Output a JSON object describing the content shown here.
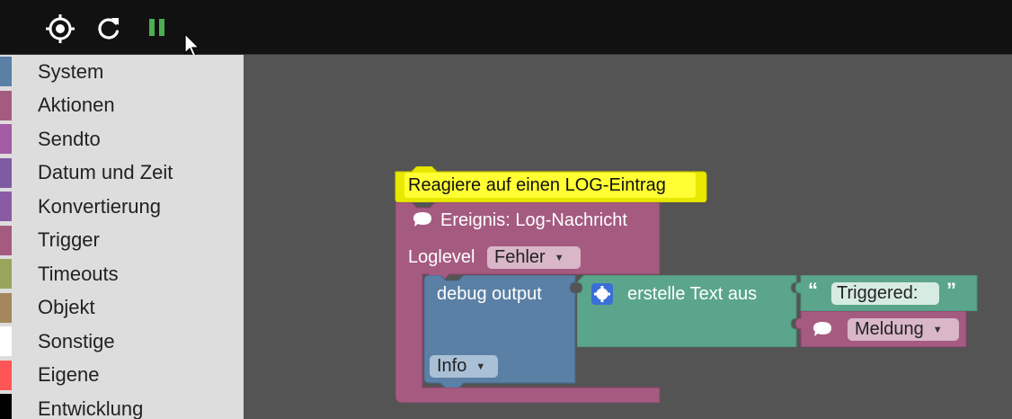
{
  "toolbar": {
    "buttons": [
      {
        "icon": "crosshair-icon"
      },
      {
        "icon": "refresh-icon"
      },
      {
        "icon": "pause-icon",
        "color": "#4caf50"
      }
    ]
  },
  "sidebar": {
    "categories": [
      {
        "label": "System",
        "color": "#5b80a5"
      },
      {
        "label": "Aktionen",
        "color": "#a55b80"
      },
      {
        "label": "Sendto",
        "color": "#a55ba5"
      },
      {
        "label": "Datum und Zeit",
        "color": "#805ba5"
      },
      {
        "label": "Konvertierung",
        "color": "#8a5ba5"
      },
      {
        "label": "Trigger",
        "color": "#a55b80"
      },
      {
        "label": "Timeouts",
        "color": "#99a55b"
      },
      {
        "label": "Objekt",
        "color": "#a5875b"
      },
      {
        "label": "Sonstige",
        "color": "#ffffff"
      },
      {
        "label": "Eigene",
        "color": "#ff5555"
      },
      {
        "label": "Entwicklung",
        "color": "#000000"
      }
    ]
  },
  "blocks": {
    "comment": "Reagiere auf einen LOG-Eintrag",
    "event": {
      "title": "Ereignis: Log-Nachricht",
      "loglevel_label": "Loglevel",
      "loglevel_value": "Fehler",
      "color": "#a55b80"
    },
    "debug": {
      "label": "debug output",
      "level": "Info",
      "color": "#5b80a5"
    },
    "text_join": {
      "label": "erstelle Text aus",
      "string_value": "Triggered:",
      "var_value": "Meldung",
      "color": "#5ba58c"
    }
  }
}
